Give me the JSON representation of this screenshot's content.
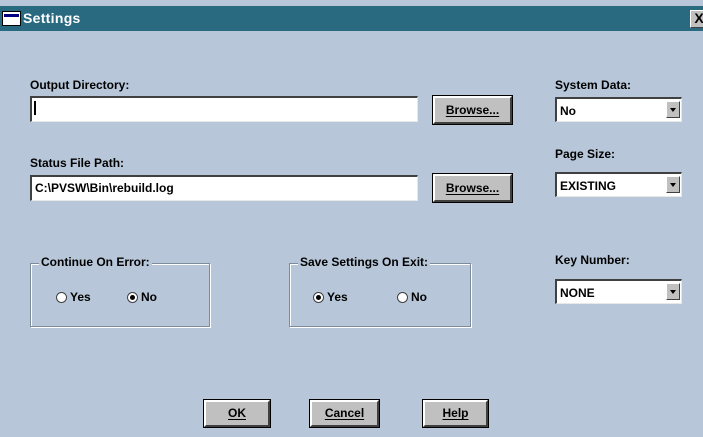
{
  "window": {
    "title": "Settings",
    "close_glyph": "X"
  },
  "output_directory": {
    "label": "Output Directory:",
    "value": "",
    "browse_label": "Browse..."
  },
  "status_file_path": {
    "label": "Status File Path:",
    "value": "C:\\PVSW\\Bin\\rebuild.log",
    "browse_label": "Browse..."
  },
  "system_data": {
    "label": "System Data:",
    "selected": "No"
  },
  "page_size": {
    "label": "Page Size:",
    "selected": "EXISTING"
  },
  "key_number": {
    "label": "Key Number:",
    "selected": "NONE"
  },
  "continue_on_error": {
    "title": "Continue On Error:",
    "options": [
      {
        "label": "Yes",
        "checked": false
      },
      {
        "label": "No",
        "checked": true
      }
    ]
  },
  "save_settings_on_exit": {
    "title": "Save Settings On Exit:",
    "options": [
      {
        "label": "Yes",
        "checked": true
      },
      {
        "label": "No",
        "checked": false
      }
    ]
  },
  "buttons": {
    "ok_label": "OK",
    "cancel_label": "Cancel",
    "help_label": "Help"
  },
  "colors": {
    "titlebar": "#2a6a80",
    "dialog_background": "#b7c7d9",
    "button_face": "#c0c0c0"
  }
}
